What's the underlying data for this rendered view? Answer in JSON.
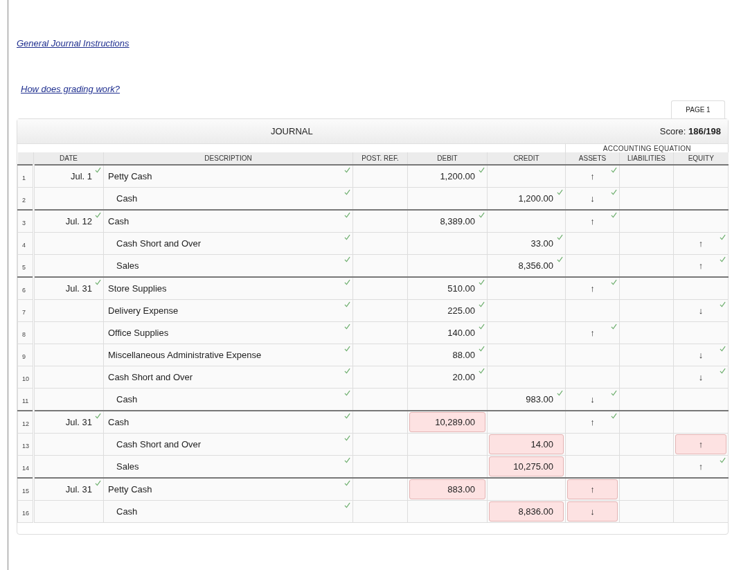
{
  "links": [
    {
      "text": "General Journal Instructions"
    },
    {
      "text": "How does grading work?"
    }
  ],
  "page_tab": {
    "label": "PAGE 1",
    "selected": true
  },
  "journal": {
    "title": "JOURNAL",
    "score": "Score: **186/198**",
    "group_header": "ACCOUNTING EQUATION",
    "columns": [
      "DATE",
      "DESCRIPTION",
      "POST. REF.",
      "DEBIT",
      "CREDIT",
      "ASSETS",
      "LIABILITIES",
      "EQUITY"
    ],
    "rows": [
      {
        "number": "1",
        "entry_start": true,
        "indent": false,
        "date": {
          "text": "Jul. 1",
          "correct": true
        },
        "description": {
          "text": "Petty Cash",
          "correct": true
        },
        "debit": {
          "text": "1,200.00",
          "correct": true
        },
        "assets": {
          "text": "↑",
          "correct": true
        }
      },
      {
        "number": "2",
        "entry_start": false,
        "indent": true,
        "description": {
          "text": "Cash",
          "correct": true
        },
        "credit": {
          "text": "1,200.00",
          "correct": true
        },
        "assets": {
          "text": "↓",
          "correct": true
        }
      },
      {
        "number": "3",
        "entry_start": true,
        "indent": false,
        "date": {
          "text": "Jul. 12",
          "correct": true
        },
        "description": {
          "text": "Cash",
          "correct": true
        },
        "debit": {
          "text": "8,389.00",
          "correct": true
        },
        "assets": {
          "text": "↑",
          "correct": true
        }
      },
      {
        "number": "4",
        "entry_start": false,
        "indent": true,
        "description": {
          "text": "Cash Short and Over",
          "correct": true
        },
        "credit": {
          "text": "33.00",
          "correct": true
        },
        "equity": {
          "text": "↑",
          "correct": true
        }
      },
      {
        "number": "5",
        "entry_start": false,
        "indent": true,
        "description": {
          "text": "Sales",
          "correct": true
        },
        "credit": {
          "text": "8,356.00",
          "correct": true
        },
        "equity": {
          "text": "↑",
          "correct": true
        }
      },
      {
        "number": "6",
        "entry_start": true,
        "indent": false,
        "date": {
          "text": "Jul. 31",
          "correct": true
        },
        "description": {
          "text": "Store Supplies",
          "correct": true
        },
        "debit": {
          "text": "510.00",
          "correct": true
        },
        "assets": {
          "text": "↑",
          "correct": true
        }
      },
      {
        "number": "7",
        "entry_start": false,
        "indent": false,
        "description": {
          "text": "Delivery Expense",
          "correct": true
        },
        "debit": {
          "text": "225.00",
          "correct": true
        },
        "equity": {
          "text": "↓",
          "correct": true
        }
      },
      {
        "number": "8",
        "entry_start": false,
        "indent": false,
        "description": {
          "text": "Office Supplies",
          "correct": true
        },
        "debit": {
          "text": "140.00",
          "correct": true
        },
        "assets": {
          "text": "↑",
          "correct": true
        }
      },
      {
        "number": "9",
        "entry_start": false,
        "indent": false,
        "description": {
          "text": "Miscellaneous Administrative Expense",
          "correct": true
        },
        "debit": {
          "text": "88.00",
          "correct": true
        },
        "equity": {
          "text": "↓",
          "correct": true
        }
      },
      {
        "number": "10",
        "entry_start": false,
        "indent": false,
        "description": {
          "text": "Cash Short and Over",
          "correct": true
        },
        "debit": {
          "text": "20.00",
          "correct": true
        },
        "equity": {
          "text": "↓",
          "correct": true
        }
      },
      {
        "number": "11",
        "entry_start": false,
        "indent": true,
        "description": {
          "text": "Cash",
          "correct": true
        },
        "credit": {
          "text": "983.00",
          "correct": true
        },
        "assets": {
          "text": "↓",
          "correct": true
        }
      },
      {
        "number": "12",
        "entry_start": true,
        "indent": false,
        "date": {
          "text": "Jul. 31",
          "correct": true
        },
        "description": {
          "text": "Cash",
          "correct": true
        },
        "debit": {
          "text": "10,289.00",
          "correct": false
        },
        "assets": {
          "text": "↑",
          "correct": true
        }
      },
      {
        "number": "13",
        "entry_start": false,
        "indent": true,
        "description": {
          "text": "Cash Short and Over",
          "correct": true
        },
        "credit": {
          "text": "14.00",
          "correct": false
        },
        "equity": {
          "text": "↑",
          "correct": false
        }
      },
      {
        "number": "14",
        "entry_start": false,
        "indent": true,
        "description": {
          "text": "Sales",
          "correct": true
        },
        "credit": {
          "text": "10,275.00",
          "correct": false
        },
        "equity": {
          "text": "↑",
          "correct": true
        }
      },
      {
        "number": "15",
        "entry_start": true,
        "indent": false,
        "date": {
          "text": "Jul. 31",
          "correct": true
        },
        "description": {
          "text": "Petty Cash",
          "correct": true
        },
        "debit": {
          "text": "883.00",
          "correct": false
        },
        "assets": {
          "text": "↑",
          "correct": false
        }
      },
      {
        "number": "16",
        "entry_start": false,
        "indent": true,
        "description": {
          "text": "Cash",
          "correct": true
        },
        "credit": {
          "text": "8,836.00",
          "correct": false
        },
        "assets": {
          "text": "↓",
          "correct": false
        }
      }
    ]
  }
}
